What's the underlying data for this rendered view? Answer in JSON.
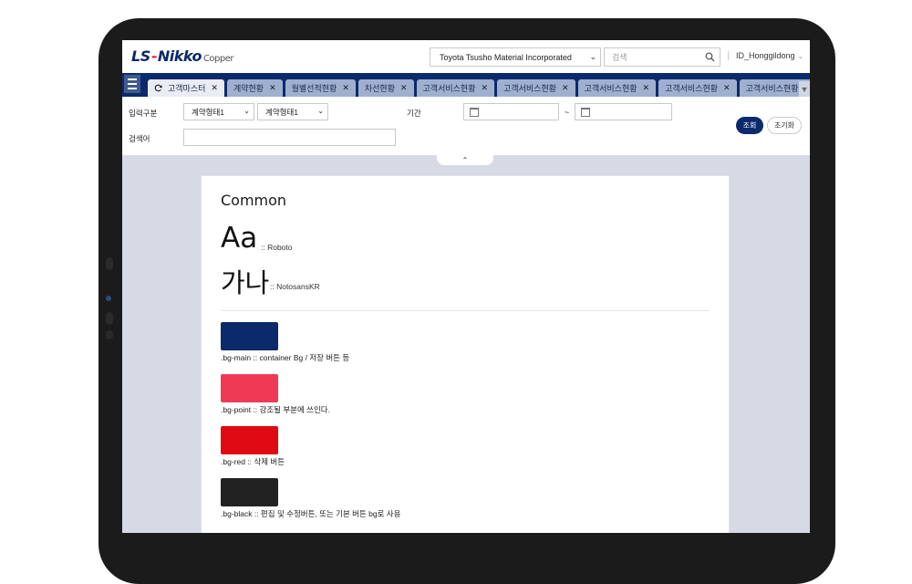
{
  "header": {
    "logo_main": "LS",
    "logo_dash": "-",
    "logo_brand": "Nikko",
    "logo_sub": "Copper",
    "company_select": "Toyota Tsusho Material Incorporated",
    "search_placeholder": "검색",
    "user_id": "ID_Honggildong"
  },
  "tabs": [
    {
      "label": "고객마스터",
      "active": true
    },
    {
      "label": "계약현황"
    },
    {
      "label": "월별선적현황"
    },
    {
      "label": "차선현황"
    },
    {
      "label": "고객서비스현황"
    },
    {
      "label": "고객서비스현황"
    },
    {
      "label": "고객서비스현황"
    },
    {
      "label": "고객서비스현황"
    },
    {
      "label": "고객서비스현황"
    }
  ],
  "filter": {
    "input_type_label": "입력구분",
    "select1": "계약형태1",
    "select2": "계약형태1",
    "period_label": "기간",
    "tilde": "~",
    "keyword_label": "검색어",
    "search_button": "조회",
    "reset_button": "초기화"
  },
  "card": {
    "title": "Common",
    "latin_sample": "Aa",
    "latin_font_note": ":: Roboto",
    "korean_sample": "가나",
    "korean_font_note": ":: NotosansKR",
    "swatches": [
      {
        "color": "#0b2a6b",
        "label": ".bg-main :: container Bg / 저장 버튼 등"
      },
      {
        "color": "#f03a55",
        "label": ".bg-point :: 강조될 부분에 쓰인다."
      },
      {
        "color": "#e00a12",
        "label": ".bg-red :: 삭제 버튼"
      },
      {
        "color": "#222222",
        "label": ".bg-black :: 편집 및 수정버튼, 또는 기본 버튼 bg로 사용"
      }
    ]
  },
  "icons": {
    "menu": "hamburger-icon",
    "refresh": "refresh-icon",
    "close": "close-icon",
    "search": "search-icon",
    "calendar": "calendar-icon",
    "collapse": "chevron-up-icon"
  }
}
